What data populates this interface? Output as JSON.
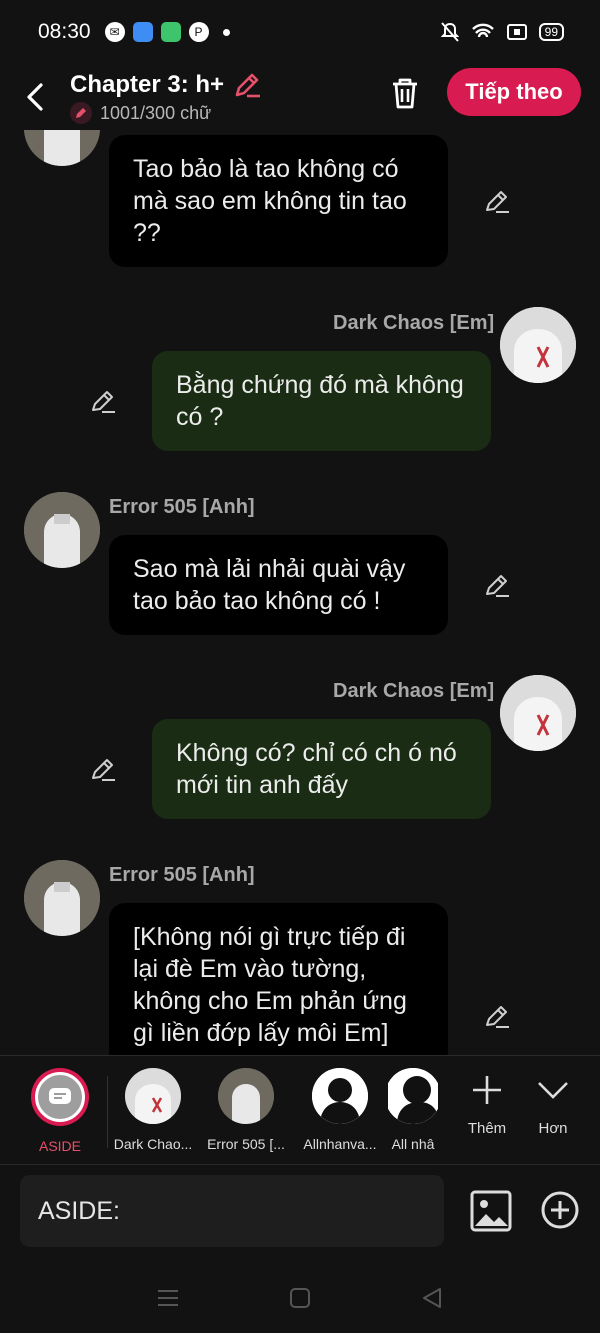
{
  "status": {
    "time": "08:30",
    "battery": "99"
  },
  "header": {
    "title": "Chapter 3: h+",
    "word_count": "1001/300 chữ",
    "next_label": "Tiếp theo",
    "accent": "#d81b50"
  },
  "messages": [
    {
      "speaker": "",
      "side": "left",
      "text": "Tao bảo là tao không có mà sao em không tin tao ??"
    },
    {
      "speaker": "Dark Chaos [Em]",
      "side": "right",
      "text": "Bằng chứng đó mà không có ?"
    },
    {
      "speaker": "Error 505 [Anh]",
      "side": "left",
      "text": "Sao mà lải nhải quài vậy tao bảo tao không có !"
    },
    {
      "speaker": "Dark Chaos [Em]",
      "side": "right",
      "text": "Không có? chỉ có ch ó nó mới tin anh đấy"
    },
    {
      "speaker": "Error 505 [Anh]",
      "side": "left",
      "text": "[Không nói gì trực tiếp đi lại đè Em vào tường, không cho Em phản ứng gì liền đớp lấy môi Em]"
    }
  ],
  "picker": {
    "aside": "ASIDE",
    "characters": [
      "Dark Chao...",
      "Error 505 [...",
      "Allnhanva...",
      "All nhâ"
    ],
    "add_label": "Thêm",
    "more_label": "Hơn"
  },
  "input": {
    "label": "ASIDE:"
  }
}
